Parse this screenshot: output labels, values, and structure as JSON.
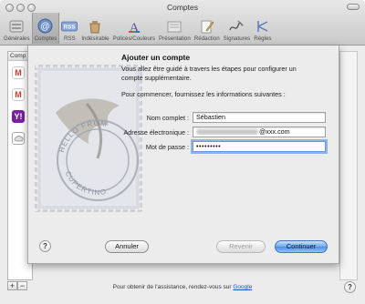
{
  "window": {
    "title": "Comptes"
  },
  "toolbar": {
    "items": [
      {
        "label": "Générales",
        "icon": "switch-icon"
      },
      {
        "label": "Comptes",
        "icon": "at-icon"
      },
      {
        "label": "RSS",
        "icon": "rss-icon"
      },
      {
        "label": "Indésirable",
        "icon": "trash-bag-icon"
      },
      {
        "label": "Polices/Couleurs",
        "icon": "font-color-icon"
      },
      {
        "label": "Présentation",
        "icon": "viewing-glasses-icon"
      },
      {
        "label": "Rédaction",
        "icon": "compose-pencil-icon"
      },
      {
        "label": "Signatures",
        "icon": "signature-pen-icon"
      },
      {
        "label": "Règles",
        "icon": "rules-icon"
      }
    ],
    "active_index": 1
  },
  "accounts_list": {
    "header": "Comp"
  },
  "sheet": {
    "title": "Ajouter un compte",
    "intro": "Vous allez être guidé à travers les étapes pour configurer un compte supplémentaire.",
    "intro2": "Pour commencer, fournissez les informations suivantes :",
    "fields": {
      "full_name": {
        "label": "Nom complet :",
        "value": "Sébastien"
      },
      "email": {
        "label": "Adresse électronique :",
        "value": "@xxx.com"
      },
      "password": {
        "label": "Mot de passe :",
        "value": "•••••••••"
      }
    },
    "buttons": {
      "cancel": "Annuler",
      "back": "Revenir",
      "continue": "Continuer"
    },
    "help": "?",
    "stamp_text": "HELLO FROM CUPERTINO"
  },
  "footer": {
    "text": "Pour obtenir de l'assistance, rendez-vous sur ",
    "link": "Google"
  },
  "bottom": {
    "add": "+",
    "remove": "−",
    "help": "?"
  },
  "colors": {
    "primary_button": "#4d8fe6",
    "focus_ring": "#8cb5ea",
    "gmail_red": "#d23b2e",
    "yahoo_purple": "#7a1fa2"
  }
}
